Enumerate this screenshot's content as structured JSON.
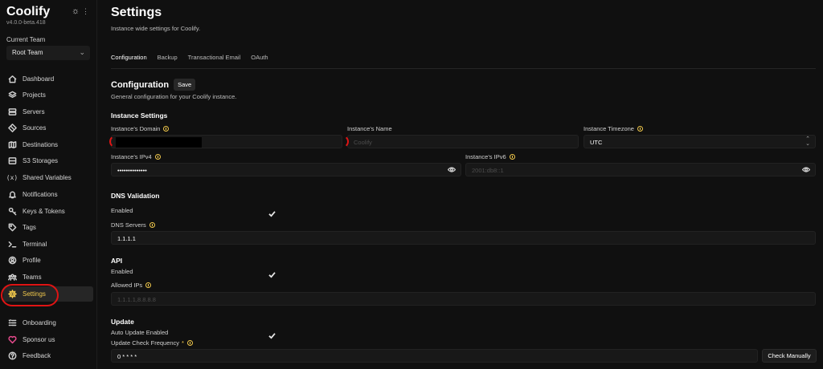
{
  "sidebar": {
    "brand": "Coolify",
    "version": "v4.0.0-beta.418",
    "team_label": "Current Team",
    "team_value": "Root Team",
    "items": [
      {
        "label": "Dashboard",
        "icon": "home-icon"
      },
      {
        "label": "Projects",
        "icon": "layers-icon"
      },
      {
        "label": "Servers",
        "icon": "server-icon"
      },
      {
        "label": "Sources",
        "icon": "git-icon"
      },
      {
        "label": "Destinations",
        "icon": "destination-icon"
      },
      {
        "label": "S3 Storages",
        "icon": "storage-icon"
      },
      {
        "label": "Shared Variables",
        "icon": "variable-icon"
      },
      {
        "label": "Notifications",
        "icon": "bell-icon"
      },
      {
        "label": "Keys & Tokens",
        "icon": "key-icon"
      },
      {
        "label": "Tags",
        "icon": "tag-icon"
      },
      {
        "label": "Terminal",
        "icon": "terminal-icon"
      },
      {
        "label": "Profile",
        "icon": "user-icon"
      },
      {
        "label": "Teams",
        "icon": "users-icon"
      },
      {
        "label": "Settings",
        "icon": "gear-icon"
      },
      {
        "label": "Onboarding",
        "icon": "checklist-icon"
      },
      {
        "label": "Sponsor us",
        "icon": "heart-icon"
      },
      {
        "label": "Feedback",
        "icon": "help-icon"
      }
    ],
    "active": "Settings"
  },
  "header": {
    "title": "Settings",
    "subtitle": "Instance wide settings for Coolify."
  },
  "tabs": [
    "Configuration",
    "Backup",
    "Transactional Email",
    "OAuth"
  ],
  "config": {
    "title": "Configuration",
    "save_label": "Save",
    "subtitle": "General configuration for your Coolify instance."
  },
  "instance": {
    "heading": "Instance Settings",
    "domain_label": "Instance's Domain",
    "domain_value": "",
    "name_label": "Instance's Name",
    "name_placeholder": "Coolify",
    "timezone_label": "Instance Timezone",
    "timezone_value": "UTC",
    "ipv4_label": "Instance's IPv4",
    "ipv4_value": "••••••••••••••",
    "ipv6_label": "Instance's IPv6",
    "ipv6_placeholder": "2001:db8::1"
  },
  "dns": {
    "heading": "DNS Validation",
    "enabled_label": "Enabled",
    "enabled": true,
    "servers_label": "DNS Servers",
    "servers_value": "1.1.1.1"
  },
  "api": {
    "heading": "API",
    "enabled_label": "Enabled",
    "enabled": true,
    "allowed_label": "Allowed IPs",
    "allowed_placeholder": "1.1.1.1,8.8.8.8"
  },
  "update": {
    "heading": "Update",
    "auto_label": "Auto Update Enabled",
    "auto_enabled": true,
    "freq_label": "Update Check Frequency",
    "required_mark": "*",
    "freq_value": "0 * * * *",
    "check_button": "Check Manually"
  },
  "colors": {
    "background": "#101010",
    "accent": "#f2c94c",
    "annotation": "#e01414",
    "sponsor": "#e44a8c"
  }
}
